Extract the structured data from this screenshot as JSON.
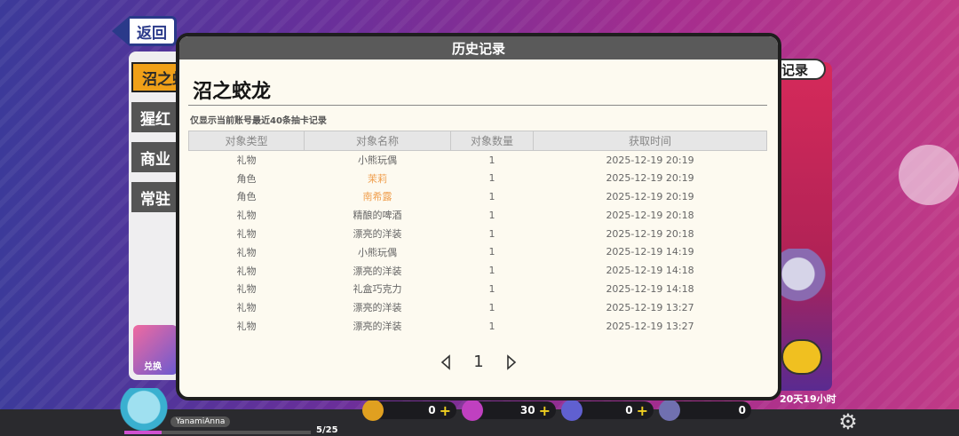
{
  "back_button": {
    "label": "返回"
  },
  "left_tabs": [
    {
      "label": "沼之蛟龙",
      "active": true
    },
    {
      "label": "猩红",
      "active": false
    },
    {
      "label": "商业",
      "active": false
    },
    {
      "label": "常驻",
      "active": false
    }
  ],
  "promo_label": "兑换",
  "right_tag": "记录",
  "timer": "20天19小时",
  "user": {
    "name": "YanamiAnna",
    "level_progress": "5/25",
    "level_fraction": 0.2
  },
  "currencies": [
    {
      "value": "0",
      "color": "#e0a020"
    },
    {
      "value": "30",
      "color": "#c040c0"
    },
    {
      "value": "0",
      "color": "#6060d0"
    },
    {
      "value": "0",
      "color": "#7070b0"
    }
  ],
  "modal": {
    "header": "历史记录",
    "title": "沼之蛟龙",
    "note": "仅显示当前账号最近40条抽卡记录",
    "columns": [
      "对象类型",
      "对象名称",
      "对象数量",
      "获取时间"
    ],
    "rows": [
      {
        "type": "礼物",
        "name": "小熊玩偶",
        "qty": "1",
        "time": "2025-12-19 20:19",
        "highlight": false
      },
      {
        "type": "角色",
        "name": "茉莉",
        "qty": "1",
        "time": "2025-12-19 20:19",
        "highlight": true
      },
      {
        "type": "角色",
        "name": "南希露",
        "qty": "1",
        "time": "2025-12-19 20:19",
        "highlight": true
      },
      {
        "type": "礼物",
        "name": "精酿的啤酒",
        "qty": "1",
        "time": "2025-12-19 20:18",
        "highlight": false
      },
      {
        "type": "礼物",
        "name": "漂亮的洋装",
        "qty": "1",
        "time": "2025-12-19 20:18",
        "highlight": false
      },
      {
        "type": "礼物",
        "name": "小熊玩偶",
        "qty": "1",
        "time": "2025-12-19 14:19",
        "highlight": false
      },
      {
        "type": "礼物",
        "name": "漂亮的洋装",
        "qty": "1",
        "time": "2025-12-19 14:18",
        "highlight": false
      },
      {
        "type": "礼物",
        "name": "礼盒巧克力",
        "qty": "1",
        "time": "2025-12-19 14:18",
        "highlight": false
      },
      {
        "type": "礼物",
        "name": "漂亮的洋装",
        "qty": "1",
        "time": "2025-12-19 13:27",
        "highlight": false
      },
      {
        "type": "礼物",
        "name": "漂亮的洋装",
        "qty": "1",
        "time": "2025-12-19 13:27",
        "highlight": false
      }
    ],
    "page": "1"
  }
}
